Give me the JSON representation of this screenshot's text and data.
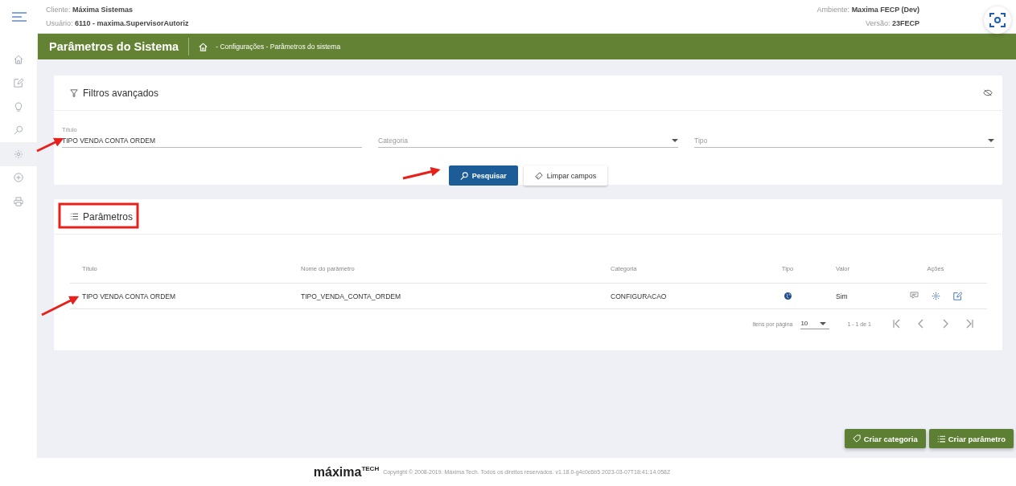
{
  "header": {
    "client_label": "Cliente:",
    "client": "Máxima Sistemas",
    "user_label": "Usuário:",
    "user": "6110 - maxima.SupervisorAutoriz",
    "env_label": "Ambiente:",
    "env": "Maxima FECP (Dev)",
    "version_label": "Versão:",
    "version": "23FECP"
  },
  "sidebar": {
    "items": [
      {
        "kind": "home",
        "selected": false
      },
      {
        "kind": "edit",
        "selected": false
      },
      {
        "kind": "bulb",
        "selected": false
      },
      {
        "kind": "search",
        "selected": false
      },
      {
        "kind": "gear",
        "selected": true
      },
      {
        "kind": "plus",
        "selected": false
      },
      {
        "kind": "printer",
        "selected": false
      }
    ]
  },
  "page_header": {
    "title": "Parâmetros do Sistema",
    "breadcrumb": "- Configurações - Parâmetros do sistema"
  },
  "filters": {
    "title": "Filtros avançados",
    "fields": [
      {
        "kind": "text",
        "label": "Título",
        "value": "TIPO VENDA CONTA ORDEM"
      },
      {
        "kind": "select",
        "placeholder": "Categoria"
      },
      {
        "kind": "select",
        "placeholder": "Tipo"
      }
    ],
    "buttons": [
      {
        "kind": "primary",
        "label": "Pesquisar"
      },
      {
        "kind": "secondary",
        "label": "Limpar campos"
      }
    ]
  },
  "parameters": {
    "title": "Parâmetros",
    "table": {
      "columns": [
        "Título",
        "Nome do parâmetro",
        "Categoria",
        "Tipo",
        "Valor",
        "Ações"
      ],
      "rows": [
        {
          "title": "TIPO VENDA CONTA ORDEM",
          "name": "TIPO_VENDA_CONTA_ORDEM",
          "category": "CONFIGURACAO",
          "value": "Sim"
        }
      ]
    },
    "pagination": {
      "label": "Itens por página",
      "page_size": "10",
      "range": "1 - 1 de 1"
    }
  },
  "actions": [
    {
      "kind": "tag",
      "label": "Criar categoria"
    },
    {
      "kind": "list",
      "label": "Criar parâmetro"
    }
  ],
  "footer": {
    "logo": "máxima",
    "logo_sup": "TECH",
    "copyright": "Copyright © 2008-2019. Máxima Tech. Todos os direitos reservados. v1.18.0-g4c0c6b5 2023-03-07T18:41:14.058Z"
  }
}
